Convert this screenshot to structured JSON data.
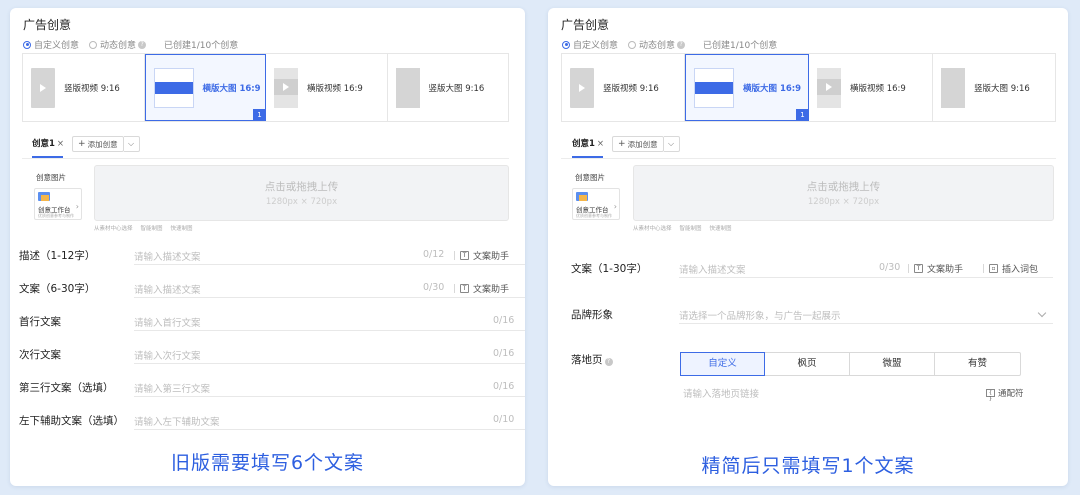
{
  "left": {
    "section_title": "广告创意",
    "radio_options": [
      "自定义创意",
      "动态创意"
    ],
    "created_note": "已创建1/10个创意",
    "cards": [
      {
        "label": "竖版视频 9:16",
        "thumb": "vertical-video"
      },
      {
        "label": "横版大图 16:9",
        "thumb": "horizontal-image",
        "active": true,
        "badge": "1"
      },
      {
        "label": "横版视频 16:9",
        "thumb": "horizontal-video"
      },
      {
        "label": "竖版大图 9:16",
        "thumb": "vertical-image"
      }
    ],
    "tab_label": "创意1",
    "tab_close": "×",
    "add_button": "添加创意",
    "image_label": "创意图片",
    "workbench_title": "创意工作台",
    "workbench_sub": "优质创意参考与制作",
    "upload_title": "点击或拖拽上传",
    "upload_size": "1280px × 720px",
    "tools": [
      "从素材中心选择",
      "智能制图",
      "快速制图"
    ],
    "fields": [
      {
        "label": "描述（1-12字）",
        "placeholder": "请输入描述文案",
        "count": "0/12",
        "helper": "文案助手"
      },
      {
        "label": "文案（6-30字）",
        "placeholder": "请输入描述文案",
        "count": "0/30",
        "helper": "文案助手"
      },
      {
        "label": "首行文案",
        "placeholder": "请输入首行文案",
        "count": "0/16"
      },
      {
        "label": "次行文案",
        "placeholder": "请输入次行文案",
        "count": "0/16"
      },
      {
        "label": "第三行文案（选填）",
        "placeholder": "请输入第三行文案",
        "count": "0/16"
      },
      {
        "label": "左下辅助文案（选填）",
        "placeholder": "请输入左下辅助文案",
        "count": "0/10"
      }
    ],
    "caption": "旧版需要填写6个文案"
  },
  "right": {
    "section_title": "广告创意",
    "radio_options": [
      "自定义创意",
      "动态创意"
    ],
    "created_note": "已创建1/10个创意",
    "cards": [
      {
        "label": "竖版视频 9:16",
        "thumb": "vertical-video"
      },
      {
        "label": "横版大图 16:9",
        "thumb": "horizontal-image",
        "active": true,
        "badge": "1"
      },
      {
        "label": "横版视频 16:9",
        "thumb": "horizontal-video"
      },
      {
        "label": "竖版大图 9:16",
        "thumb": "vertical-image"
      }
    ],
    "tab_label": "创意1",
    "tab_close": "×",
    "add_button": "添加创意",
    "image_label": "创意图片",
    "workbench_title": "创意工作台",
    "workbench_sub": "优质创意参考与制作",
    "upload_title": "点击或拖拽上传",
    "upload_size": "1280px × 720px",
    "tools": [
      "从素材中心选择",
      "智能制图",
      "快速制图"
    ],
    "copy_field": {
      "label": "文案（1-30字）",
      "placeholder": "请输入描述文案",
      "count": "0/30",
      "helper": "文案助手",
      "helper2": "插入词包"
    },
    "brand_field": {
      "label": "品牌形象",
      "placeholder": "请选择一个品牌形象，与广告一起展示"
    },
    "landing": {
      "label": "落地页",
      "options": [
        "自定义",
        "枫页",
        "微盟",
        "有赞"
      ],
      "placeholder": "请输入落地页链接",
      "wildcard": "通配符"
    },
    "caption": "精简后只需填写1个文案"
  },
  "colors": {
    "accent": "#3d6be6",
    "caption": "#2d5fe0",
    "background": "#dfeaf8"
  }
}
